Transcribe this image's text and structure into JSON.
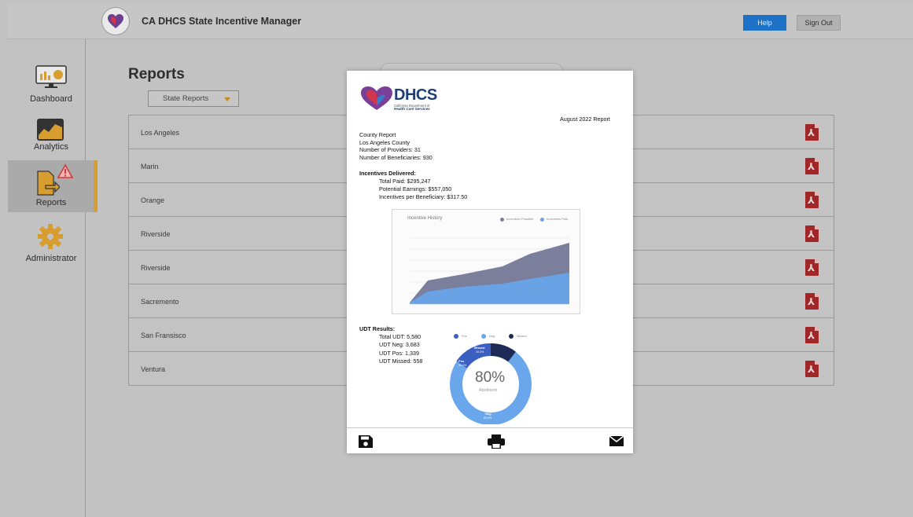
{
  "app": {
    "title": "CA DHCS State Incentive Manager",
    "logo_text": "DHCS",
    "help_label": "Help",
    "signout_label": "Sign Out"
  },
  "sidebar": {
    "items": [
      {
        "label": "Dashboard",
        "icon": "dashboard-monitor-icon"
      },
      {
        "label": "Analytics",
        "icon": "analytics-chart-icon"
      },
      {
        "label": "Reports",
        "icon": "reports-folder-icon",
        "active": true,
        "alert": true
      },
      {
        "label": "Administrator",
        "icon": "gear-icon"
      }
    ]
  },
  "main": {
    "title": "Reports",
    "filter_selected": "State Reports",
    "counties": [
      "Los Angeles",
      "Marin",
      "Orange",
      "Riverside",
      "Riverside",
      "Sacremento",
      "San Fransisco",
      "Ventura"
    ]
  },
  "report": {
    "logo_text": "DHCS",
    "logo_sub1": "California Department of",
    "logo_sub2": "Health Care Services",
    "date": "August 2022 Report",
    "county_header": "County Report",
    "county_name": "Los Angeles County",
    "providers": "Number of Providers: 31",
    "beneficiaries": "Number of Beneficiaries: 930",
    "incentives_header": "Incentives Delivered:",
    "total_paid": "Total Paid: $295,247",
    "potential": "Potential Earnings: $557,050",
    "per_beneficiary": "Incentives per Beneficiary: $317.50",
    "udt_header": "UDT Results:",
    "udt_total": "Total UDT: 5,580",
    "udt_neg": "UDT Neg: 3,683",
    "udt_pos": "UDT Pos: 1,339",
    "udt_missed": "UDT Missed: 558",
    "incentive_chart_title": "Incentive History",
    "incentive_legend": [
      "Incentives Possible",
      "Incentives Paid"
    ],
    "donut_center_value": "80%",
    "donut_center_label": "Abstinent",
    "donut_legend": [
      "Pos",
      "Neg",
      "Missed"
    ],
    "donut_labels": {
      "missed": "Missed",
      "missed_pct": "10.0%",
      "pos": "Pos",
      "pos_pct": "10.0%",
      "neg": "Neg",
      "neg_pct": "80.0%"
    }
  },
  "toolbar": {
    "save_icon": "save-icon",
    "print_icon": "print-icon",
    "email_icon": "email-icon"
  },
  "chart_data": {
    "type": "area",
    "title": "Incentive History",
    "series": [
      {
        "name": "Incentives Possible",
        "color": "#7b7f9c"
      },
      {
        "name": "Incentives Paid",
        "color": "#6aa2e6"
      }
    ]
  },
  "colors": {
    "accent_blue": "#1d72c7",
    "active_bar": "#d79d2e",
    "pdf_red": "#a02727"
  }
}
